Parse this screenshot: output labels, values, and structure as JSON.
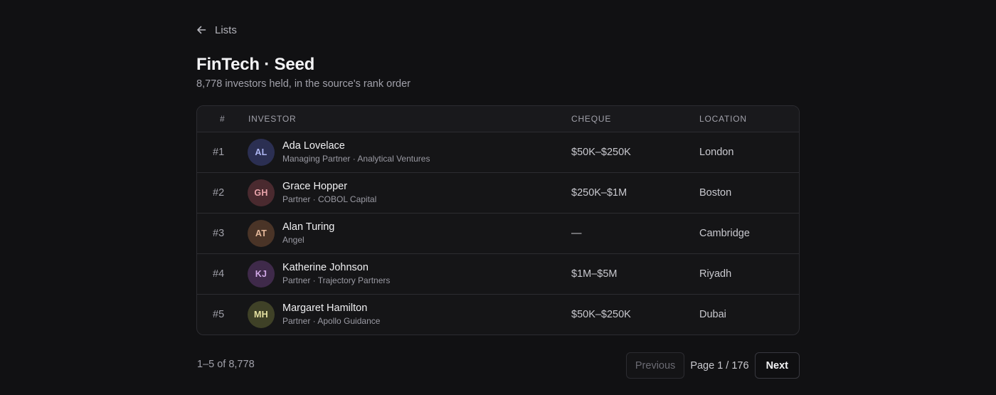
{
  "nav": {
    "back_label": "Lists"
  },
  "header": {
    "title": "FinTech · Seed",
    "subtitle": "8,778 investors held, in the source's rank order"
  },
  "table": {
    "columns": {
      "rank": "#",
      "investor": "Investor",
      "cheque": "Cheque",
      "location": "Location"
    },
    "rows": [
      {
        "rank": "#1",
        "initials": "AL",
        "name": "Ada Lovelace",
        "role": "Managing Partner · Analytical Ventures",
        "cheque": "$50K–$250K",
        "location": "London",
        "avatar_bg": "#2b2f52",
        "avatar_fg": "#aeb6f2"
      },
      {
        "rank": "#2",
        "initials": "GH",
        "name": "Grace Hopper",
        "role": "Partner · COBOL Capital",
        "cheque": "$250K–$1M",
        "location": "Boston",
        "avatar_bg": "#4a2a2f",
        "avatar_fg": "#eba5ac"
      },
      {
        "rank": "#3",
        "initials": "AT",
        "name": "Alan Turing",
        "role": "Angel",
        "cheque": "—",
        "location": "Cambridge",
        "avatar_bg": "#4a3427",
        "avatar_fg": "#e4b89a"
      },
      {
        "rank": "#4",
        "initials": "KJ",
        "name": "Katherine Johnson",
        "role": "Partner · Trajectory Partners",
        "cheque": "$1M–$5M",
        "location": "Riyadh",
        "avatar_bg": "#3f2a4a",
        "avatar_fg": "#d1a8e6"
      },
      {
        "rank": "#5",
        "initials": "MH",
        "name": "Margaret Hamilton",
        "role": "Partner · Apollo Guidance",
        "cheque": "$50K–$250K",
        "location": "Dubai",
        "avatar_bg": "#3f4127",
        "avatar_fg": "#e6e2a2"
      }
    ]
  },
  "footer": {
    "count": "1–5 of 8,778",
    "prev_label": "Previous",
    "page_indicator": "Page 1 / 176",
    "next_label": "Next"
  }
}
